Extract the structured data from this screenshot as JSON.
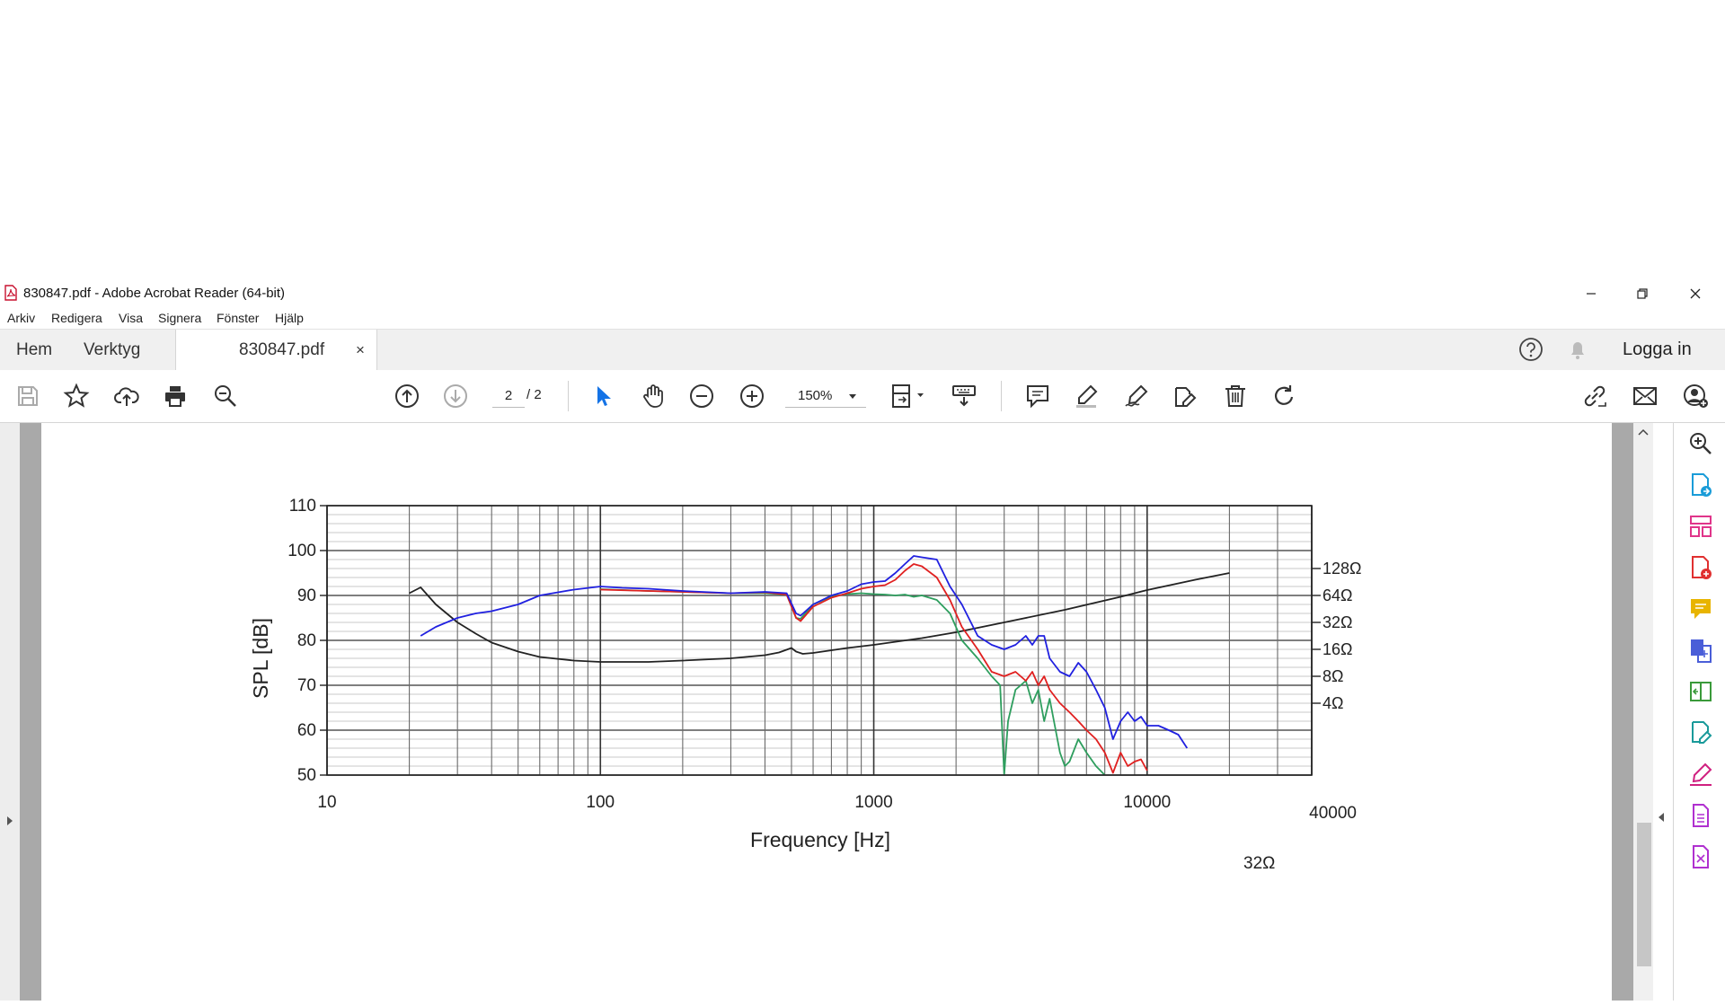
{
  "window": {
    "title": "830847.pdf - Adobe Acrobat Reader (64-bit)"
  },
  "menu": [
    "Arkiv",
    "Redigera",
    "Visa",
    "Signera",
    "Fönster",
    "Hjälp"
  ],
  "tabs": {
    "home": "Hem",
    "tools": "Verktyg",
    "document": "830847.pdf",
    "close": "×"
  },
  "header": {
    "login": "Logga in"
  },
  "toolbar": {
    "page_current": "2",
    "page_total": "/ 2",
    "zoom": "150%"
  },
  "colors": {
    "spl_blue": "#2020e0",
    "spl_red": "#e02020",
    "spl_green": "#2e9e5e",
    "impedance": "#222222",
    "accent_blue": "#1473e6"
  },
  "icons": {
    "toolbar": [
      "save-icon",
      "star-icon",
      "upload-icon",
      "print-icon",
      "search-icon",
      "arrow-up-icon",
      "arrow-down-icon",
      "cursor-icon",
      "hand-icon",
      "zoom-out-icon",
      "zoom-in-icon",
      "page-fit-icon",
      "keyboard-icon",
      "comment-icon",
      "highlight-icon",
      "sign-icon",
      "edit-icon",
      "trash-icon",
      "rotate-icon",
      "link-icon",
      "mail-icon",
      "share-user-icon"
    ],
    "right_panel": [
      "zoom-icon",
      "export-pdf-icon",
      "organize-icon",
      "create-pdf-icon",
      "comment-icon",
      "combine-icon",
      "compress-icon",
      "edit-pdf-icon",
      "fill-sign-icon",
      "document-icon",
      "document-x-icon"
    ]
  },
  "chart_data": {
    "type": "line",
    "xlabel": "Frequency [Hz]",
    "ylabel": "SPL [dB]",
    "x_scale": "log",
    "xlim": [
      10,
      40000
    ],
    "ylim": [
      50,
      110
    ],
    "x_ticks": [
      "10",
      "100",
      "1000",
      "10000"
    ],
    "x_end_label": "40000",
    "y_ticks": [
      "50",
      "60",
      "70",
      "80",
      "90",
      "100",
      "110"
    ],
    "y2_ticks": [
      {
        "label": "128Ω",
        "at": 96
      },
      {
        "label": "64Ω",
        "at": 90
      },
      {
        "label": "32Ω",
        "at": 84
      },
      {
        "label": "16Ω",
        "at": 78
      },
      {
        "label": "8Ω",
        "at": 72
      },
      {
        "label": "4Ω",
        "at": 66
      }
    ],
    "y2_extra_label": "32Ω",
    "grid": true,
    "series": [
      {
        "color": "#2020e0",
        "x": [
          22,
          25,
          30,
          35,
          40,
          50,
          60,
          70,
          80,
          100,
          120,
          150,
          200,
          300,
          400,
          480,
          520,
          540,
          600,
          700,
          800,
          900,
          1000,
          1100,
          1200,
          1300,
          1400,
          1500,
          1700,
          1900,
          2100,
          2400,
          2700,
          3000,
          3300,
          3600,
          3800,
          4000,
          4200,
          4400,
          4800,
          5200,
          5600,
          6000,
          6500,
          7000,
          7500,
          8000,
          8500,
          9000,
          9500,
          10000,
          11000,
          12000,
          13000,
          14000
        ],
        "y": [
          81,
          83,
          85,
          86,
          86.5,
          88,
          90,
          90.7,
          91.3,
          92,
          91.7,
          91.5,
          91,
          90.5,
          90.8,
          90.5,
          86,
          85.5,
          88,
          90,
          91,
          92.5,
          93,
          93.2,
          95,
          97,
          98.8,
          98.5,
          98,
          92,
          88,
          81,
          79,
          78,
          79,
          81,
          79,
          81,
          81,
          76,
          73,
          72,
          75,
          73,
          69,
          65,
          58,
          62,
          64,
          62,
          63,
          61,
          61,
          60,
          59,
          56
        ]
      },
      {
        "color": "#e02020",
        "x": [
          100,
          150,
          200,
          300,
          400,
          480,
          520,
          540,
          600,
          700,
          800,
          900,
          1000,
          1100,
          1200,
          1300,
          1400,
          1500,
          1700,
          1900,
          2100,
          2400,
          2700,
          3000,
          3300,
          3600,
          3800,
          4000,
          4200,
          4400,
          4800,
          5200,
          5600,
          6000,
          6500,
          7000,
          7500,
          8000,
          8500,
          9000,
          9500,
          10000
        ],
        "y": [
          91.3,
          91,
          90.8,
          90.5,
          90.7,
          90.2,
          85,
          84.3,
          87.5,
          89.5,
          90.5,
          91.5,
          92,
          92.3,
          93.5,
          95.5,
          97,
          96.5,
          94,
          89,
          83,
          78,
          73,
          72,
          73,
          71,
          73,
          70,
          72,
          69,
          66,
          64,
          62,
          60,
          58,
          55,
          50.5,
          55,
          52,
          53,
          53.5,
          51
        ]
      },
      {
        "color": "#2e9e5e",
        "x": [
          100,
          150,
          200,
          300,
          400,
          480,
          520,
          540,
          600,
          700,
          800,
          900,
          1000,
          1100,
          1200,
          1300,
          1400,
          1500,
          1700,
          1900,
          2100,
          2400,
          2700,
          2900,
          3000,
          3100,
          3300,
          3600,
          3800,
          4000,
          4200,
          4400,
          4800,
          5000,
          5200,
          5600,
          6000,
          6500,
          7000
        ],
        "y": [
          91.4,
          91,
          90.8,
          90.5,
          90.5,
          90.2,
          85,
          84.8,
          88,
          89.8,
          90.3,
          90.5,
          90.3,
          90.2,
          90,
          90.2,
          89.7,
          90,
          89,
          86,
          80,
          76,
          72,
          70,
          50,
          62,
          69,
          71,
          66,
          69,
          62,
          67,
          55,
          52,
          53,
          58,
          55,
          52,
          50
        ]
      },
      {
        "color": "#222222",
        "x": [
          20,
          22,
          25,
          30,
          35,
          40,
          50,
          60,
          80,
          100,
          150,
          200,
          300,
          400,
          450,
          500,
          520,
          550,
          600,
          800,
          1000,
          1500,
          2000,
          3000,
          5000,
          8000,
          10000,
          15000,
          20000
        ],
        "y": [
          90.5,
          91.8,
          88,
          84,
          81.5,
          79.5,
          77.5,
          76.3,
          75.5,
          75.2,
          75.2,
          75.5,
          76,
          76.7,
          77.3,
          78.3,
          77.5,
          77,
          77.2,
          78.3,
          79,
          80.5,
          81.8,
          84,
          86.8,
          89.7,
          91.2,
          93.5,
          95
        ]
      }
    ]
  }
}
